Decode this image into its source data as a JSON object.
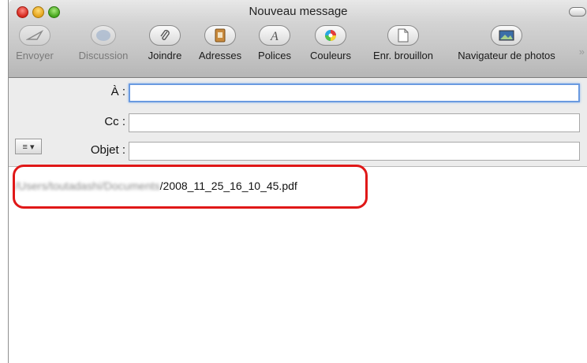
{
  "window": {
    "title": "Nouveau message"
  },
  "toolbar": {
    "items": [
      {
        "label": "Envoyer",
        "icon": "send-icon",
        "enabled": false
      },
      {
        "label": "Discussion",
        "icon": "chat-icon",
        "enabled": false
      },
      {
        "label": "Joindre",
        "icon": "paperclip-icon",
        "enabled": true
      },
      {
        "label": "Adresses",
        "icon": "address-book-icon",
        "enabled": true
      },
      {
        "label": "Polices",
        "icon": "fonts-icon",
        "enabled": true
      },
      {
        "label": "Couleurs",
        "icon": "color-wheel-icon",
        "enabled": true
      },
      {
        "label": "Enr. brouillon",
        "icon": "save-draft-icon",
        "enabled": true
      },
      {
        "label": "Navigateur de photos",
        "icon": "photo-browser-icon",
        "enabled": true
      }
    ],
    "overflow": "»"
  },
  "fields": {
    "to_label": "À :",
    "to_value": "",
    "cc_label": "Cc :",
    "cc_value": "",
    "subject_label": "Objet :",
    "subject_value": "",
    "options_label": "≡ ▾"
  },
  "body": {
    "path_blurred": "/Users/toutadashi/Documents",
    "path_file": "/2008_11_25_16_10_45.pdf"
  },
  "colors": {
    "highlight": "#e01818",
    "focus": "#6a9ae0"
  }
}
